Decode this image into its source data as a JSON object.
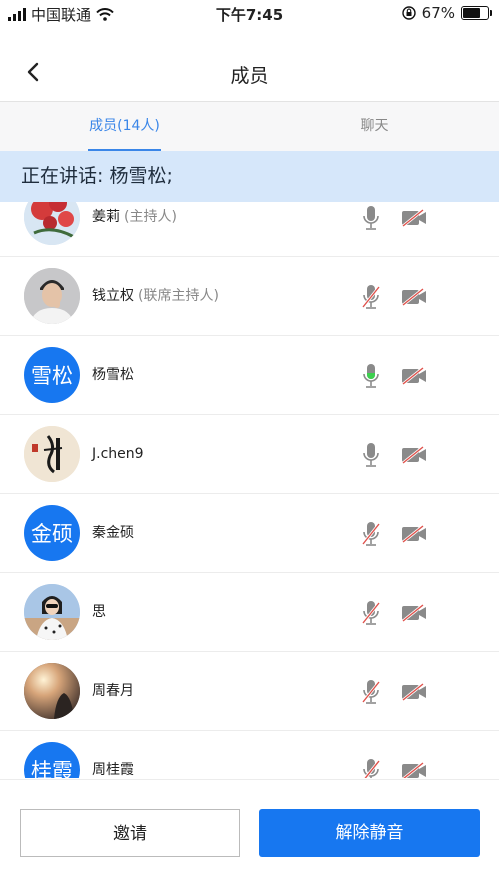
{
  "status_bar": {
    "carrier": "中国联通",
    "time": "下午7:45",
    "battery_percent": "67%",
    "battery_level": 0.67
  },
  "nav": {
    "title": "成员"
  },
  "tabs": [
    {
      "label": "成员(14人)",
      "active": true
    },
    {
      "label": "聊天",
      "active": false
    }
  ],
  "speaking": {
    "text": "正在讲话: 杨雪松;"
  },
  "members": [
    {
      "name": "姜莉",
      "role": "(主持人)",
      "avatar": "photo-flowers",
      "mic": "on",
      "cam": "off"
    },
    {
      "name": "钱立权",
      "role": "(联席主持人)",
      "avatar": "photo-man",
      "mic": "muted",
      "cam": "off"
    },
    {
      "name": "杨雪松",
      "role": "",
      "avatar_text": "雪松",
      "mic": "speaking",
      "cam": "off"
    },
    {
      "name": "J.chen9",
      "role": "",
      "avatar": "photo-calligraphy",
      "mic": "on",
      "cam": "off"
    },
    {
      "name": "秦金硕",
      "role": "",
      "avatar_text": "金硕",
      "mic": "muted",
      "cam": "off"
    },
    {
      "name": "思",
      "role": "",
      "avatar": "photo-woman",
      "mic": "muted",
      "cam": "off"
    },
    {
      "name": "周春月",
      "role": "",
      "avatar": "photo-sunset",
      "mic": "muted",
      "cam": "off"
    },
    {
      "name": "周桂霞",
      "role": "",
      "avatar_text": "桂霞",
      "mic": "muted",
      "cam": "off"
    }
  ],
  "buttons": {
    "invite": "邀请",
    "unmute": "解除静音"
  },
  "colors": {
    "accent": "#1777f0",
    "tab_active": "#3a86e8",
    "speaking_bg": "#d6e7fa",
    "mic_active": "#3ccf4e",
    "mute_slash": "#e0524c"
  }
}
